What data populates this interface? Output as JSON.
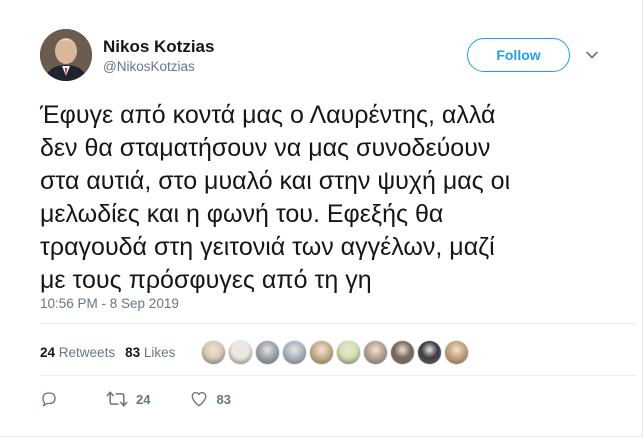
{
  "author": {
    "name": "Nikos Kotzias",
    "handle": "@NikosKotzias"
  },
  "follow_label": "Follow",
  "tweet_text": "Έφυγε από κοντά μας ο Λαυρέντης,  αλλά\nδεν θα σταματήσουν να μας συνοδεύουν\nστα αυτιά, στο μυαλό και στην ψυχή μας οι\nμελωδίες  και η φωνή του. Εφεξής θα\nτραγουδά στη γειτονιά των αγγέλων, μαζί\nμε τους πρόσφυγες από τη γη",
  "timestamp": "10:56 PM - 8 Sep 2019",
  "stats": {
    "retweets_count": "24",
    "retweets_label": "Retweets",
    "likes_count": "83",
    "likes_label": "Likes"
  },
  "liker_avatars": [
    {
      "color": "#d8c9b4"
    },
    {
      "color": "#e9e9e9"
    },
    {
      "color": "#9aa4ad"
    },
    {
      "color": "#a9b8c6"
    },
    {
      "color": "#c9b08a"
    },
    {
      "color": "#cfe0b0"
    },
    {
      "color": "#b7a393"
    },
    {
      "color": "#7a6a5e"
    },
    {
      "color": "#3c3c46"
    },
    {
      "color": "#c7a27a"
    }
  ],
  "actions": {
    "reply_icon": "reply-icon",
    "retweet_count": "24",
    "like_count": "83"
  },
  "colors": {
    "accent": "#1da1f2",
    "text": "#14171a",
    "muted": "#657786",
    "border": "#e6ecf0"
  }
}
